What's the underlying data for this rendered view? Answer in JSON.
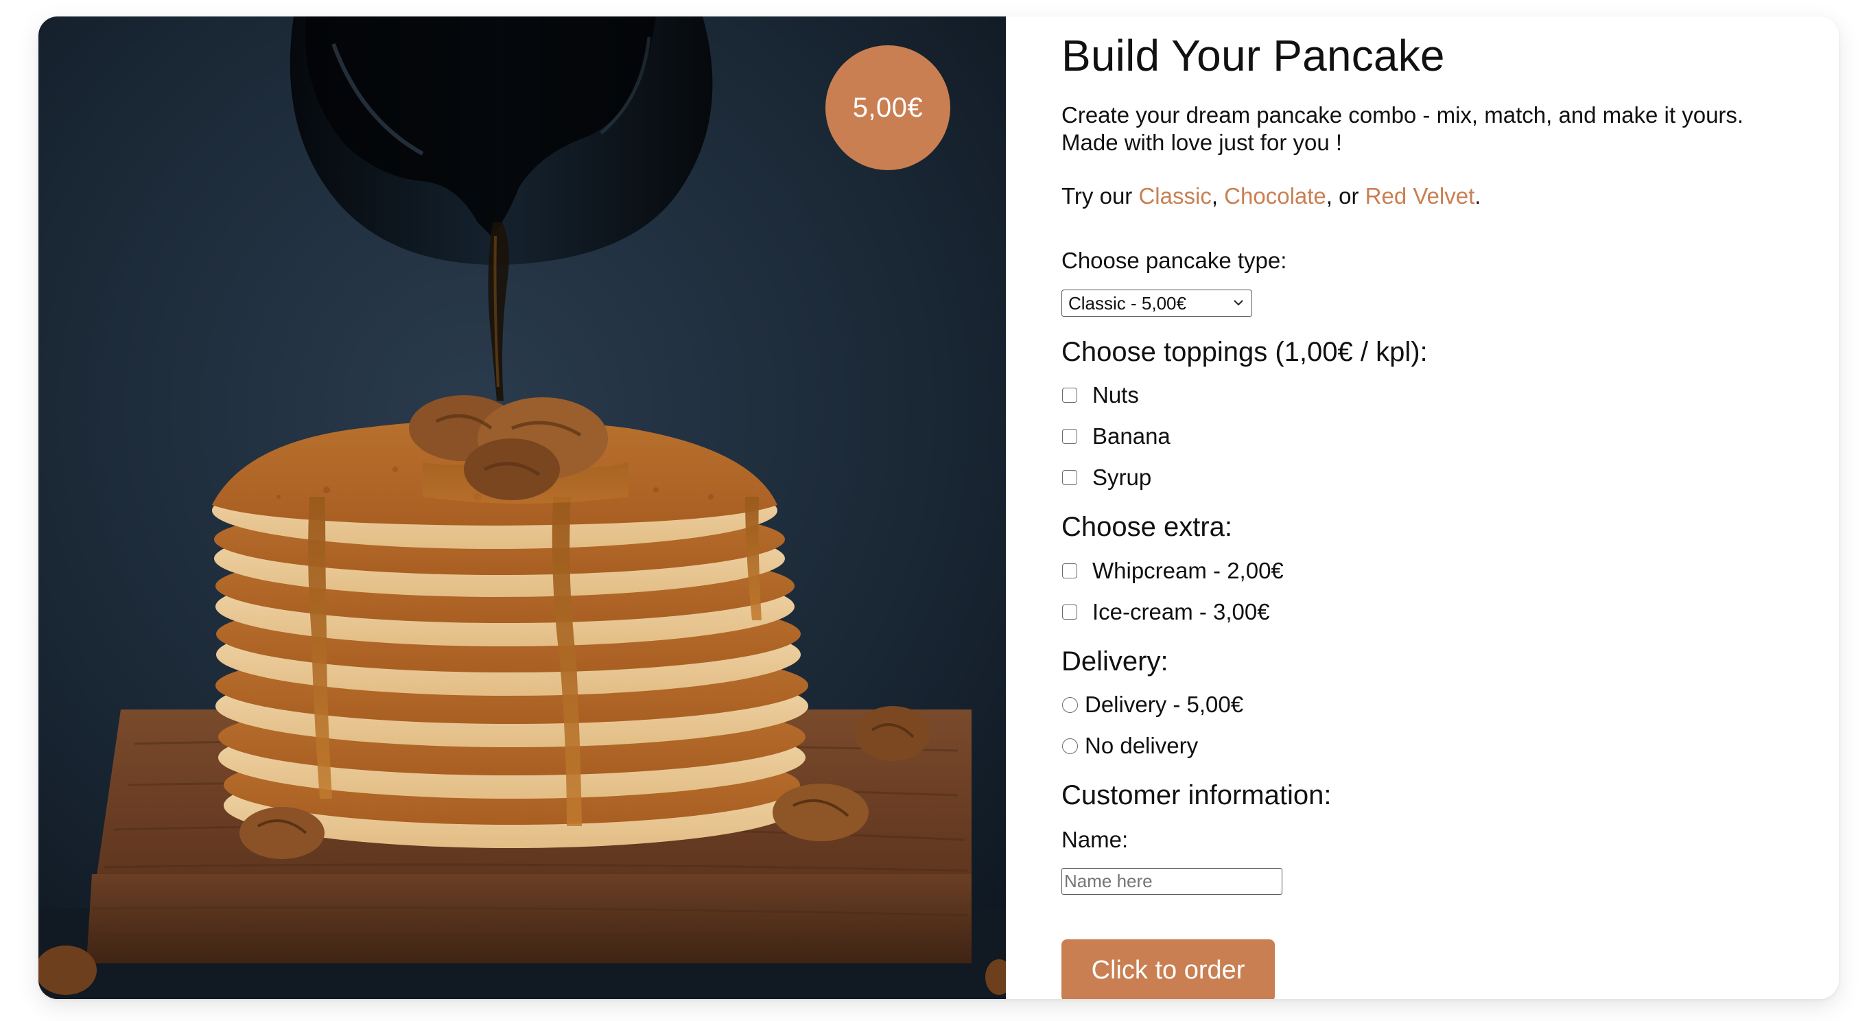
{
  "theme": {
    "accent": "#c97f52",
    "text": "#111111"
  },
  "photo": {
    "price_badge": "5,00€"
  },
  "form": {
    "title": "Build Your Pancake",
    "intro_line1": "Create your dream pancake combo - mix, match, and make it yours.",
    "intro_line2": "Made with love just for you !",
    "try_prefix": "Try our ",
    "flavors": [
      "Classic",
      "Chocolate",
      "Red Velvet"
    ],
    "sep_comma": ", ",
    "sep_or": ", or ",
    "try_suffix": ".",
    "type_label": "Choose pancake type:",
    "type_selected": "Classic - 5,00€",
    "toppings_heading": "Choose toppings (1,00€ / kpl):",
    "toppings": [
      "Nuts",
      "Banana",
      "Syrup"
    ],
    "extra_heading": "Choose extra:",
    "extras": [
      "Whipcream - 2,00€",
      "Ice-cream - 3,00€"
    ],
    "delivery_heading": "Delivery:",
    "delivery_options": [
      "Delivery - 5,00€",
      "No delivery"
    ],
    "customer_heading": "Customer information:",
    "name_label": "Name:",
    "name_placeholder": "Name here",
    "name_value": "",
    "order_button": "Click to order"
  }
}
